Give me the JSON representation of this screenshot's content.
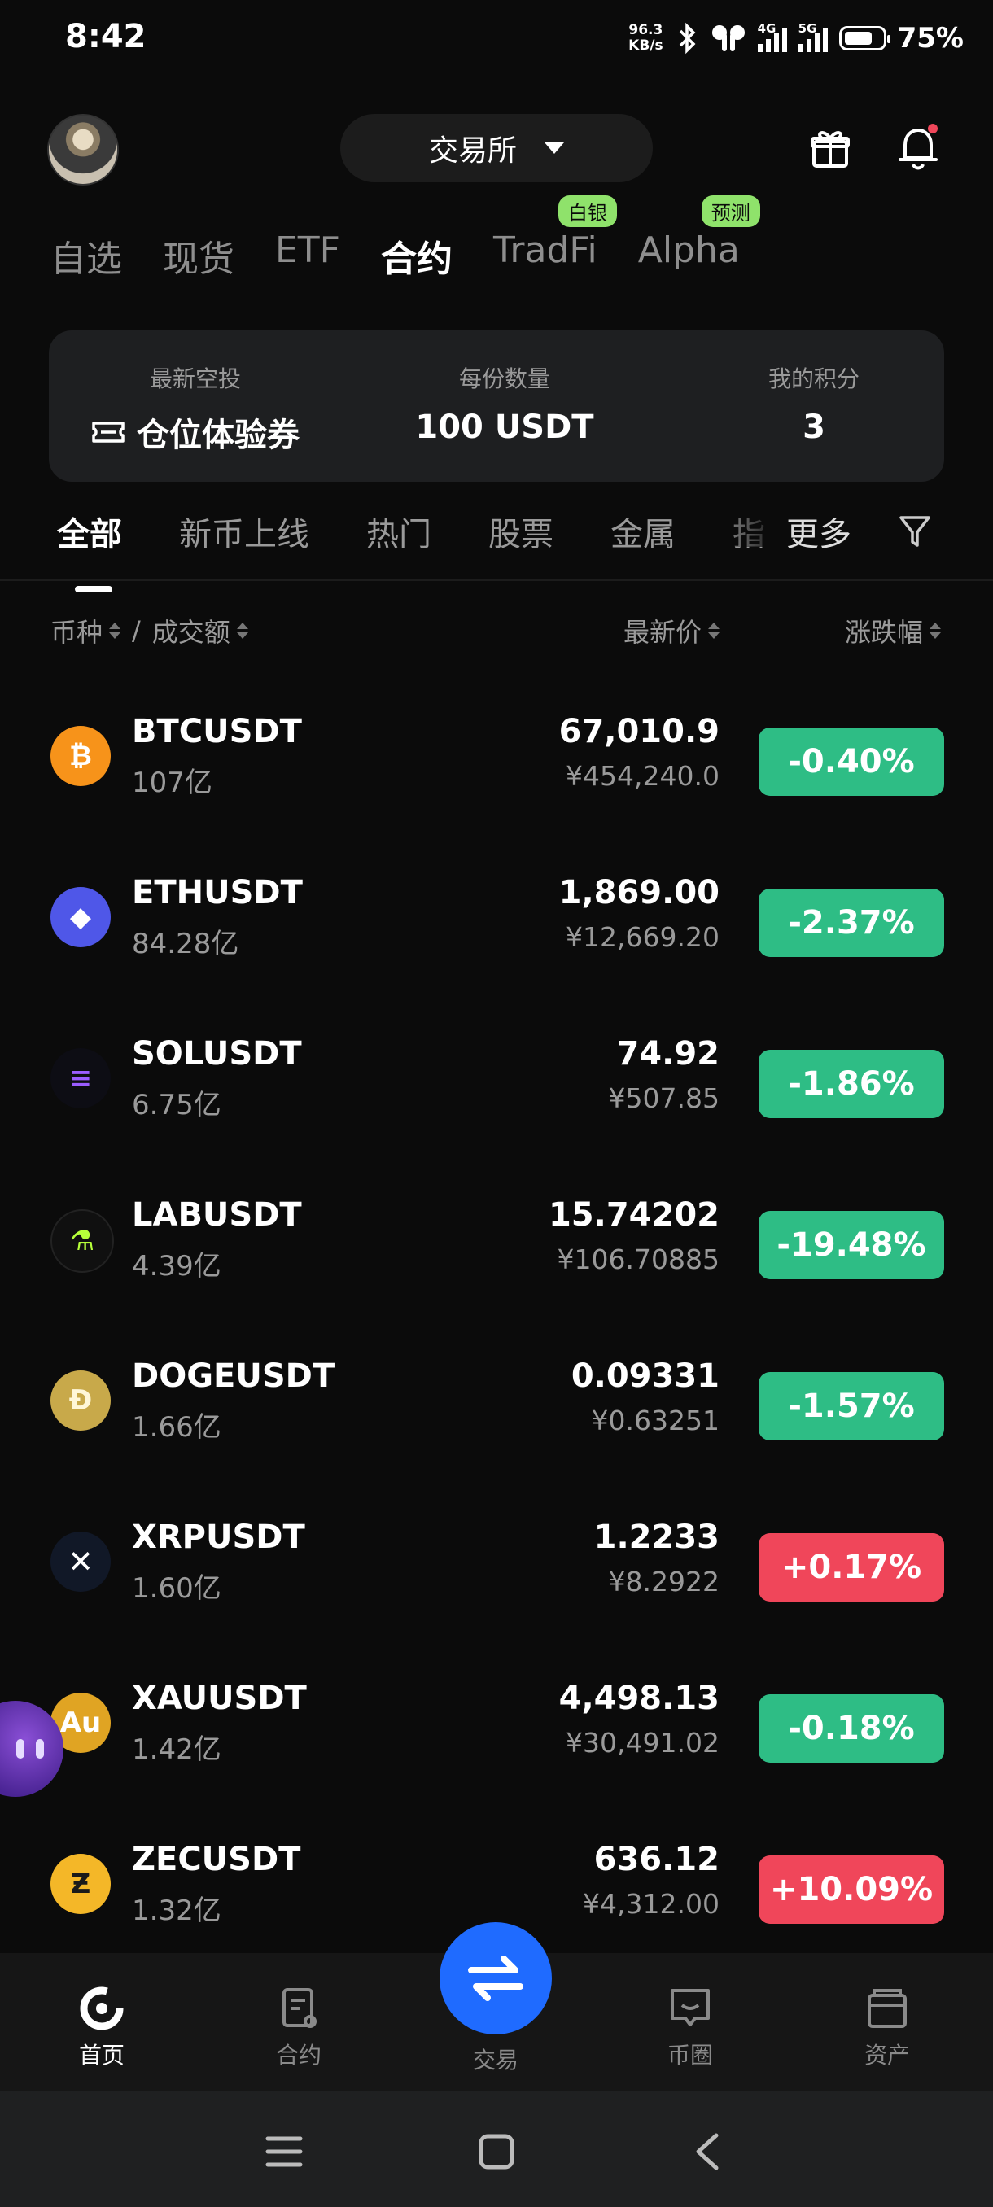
{
  "status_bar": {
    "time": "8:42",
    "net_speed_value": "96.3",
    "net_speed_unit": "KB/s",
    "signal1_label": "4G",
    "signal2_label": "5G",
    "battery_level": 0.75,
    "battery_text": "75%"
  },
  "header": {
    "exchange_label": "交易所"
  },
  "top_tabs": [
    {
      "label": "自选"
    },
    {
      "label": "现货"
    },
    {
      "label": "ETF"
    },
    {
      "label": "合约",
      "active": true
    },
    {
      "label": "TradFi",
      "badge": "白银"
    },
    {
      "label": "Alpha",
      "badge": "预测"
    }
  ],
  "promo": {
    "col1_label": "最新空投",
    "col1_value": "仓位体验券",
    "col2_label": "每份数量",
    "col2_value": "100 USDT",
    "col3_label": "我的积分",
    "col3_value": "3"
  },
  "category_tabs": [
    {
      "label": "全部",
      "active": true
    },
    {
      "label": "新币上线"
    },
    {
      "label": "热门"
    },
    {
      "label": "股票"
    },
    {
      "label": "金属"
    },
    {
      "label": "指"
    }
  ],
  "category_more": "更多",
  "columns": {
    "coin": "币种",
    "separator": "/",
    "volume": "成交额",
    "price": "最新价",
    "change": "涨跌幅"
  },
  "rows": [
    {
      "symbol": "BTCUSDT",
      "volume": "107亿",
      "price": "67,010.9",
      "cny": "¥454,240.0",
      "change": "-0.40%",
      "dir": "down",
      "icon": "bitcoin-icon",
      "icon_color": "#f7931a",
      "glyph": "₿"
    },
    {
      "symbol": "ETHUSDT",
      "volume": "84.28亿",
      "price": "1,869.00",
      "cny": "¥12,669.20",
      "change": "-2.37%",
      "dir": "down",
      "icon": "ethereum-icon",
      "icon_color": "#4f57e8",
      "glyph": "◆"
    },
    {
      "symbol": "SOLUSDT",
      "volume": "6.75亿",
      "price": "74.92",
      "cny": "¥507.85",
      "change": "-1.86%",
      "dir": "down",
      "icon": "solana-icon",
      "icon_color": "#0d0d14",
      "glyph": "≡"
    },
    {
      "symbol": "LABUSDT",
      "volume": "4.39亿",
      "price": "15.74202",
      "cny": "¥106.70885",
      "change": "-19.48%",
      "dir": "down",
      "icon": "lab-flask-icon",
      "icon_color": "#101010",
      "glyph": "⚗"
    },
    {
      "symbol": "DOGEUSDT",
      "volume": "1.66亿",
      "price": "0.09331",
      "cny": "¥0.63251",
      "change": "-1.57%",
      "dir": "down",
      "icon": "dogecoin-icon",
      "icon_color": "#c8a94a",
      "glyph": "Ð"
    },
    {
      "symbol": "XRPUSDT",
      "volume": "1.60亿",
      "price": "1.2233",
      "cny": "¥8.2922",
      "change": "+0.17%",
      "dir": "up",
      "icon": "xrp-icon",
      "icon_color": "#111827",
      "glyph": "✕"
    },
    {
      "symbol": "XAUUSDT",
      "volume": "1.42亿",
      "price": "4,498.13",
      "cny": "¥30,491.02",
      "change": "-0.18%",
      "dir": "down",
      "icon": "gold-au-icon",
      "icon_color": "#e0a423",
      "glyph": "Au"
    },
    {
      "symbol": "ZECUSDT",
      "volume": "1.32亿",
      "price": "636.12",
      "cny": "¥4,312.00",
      "change": "+10.09%",
      "dir": "up",
      "icon": "zcash-icon",
      "icon_color": "#f4b728",
      "glyph": "Ƶ"
    }
  ],
  "bottom_nav": [
    {
      "label": "首页",
      "icon": "home-icon",
      "active": true
    },
    {
      "label": "合约",
      "icon": "contract-icon"
    },
    {
      "label": "交易",
      "icon": "swap-arrows-icon"
    },
    {
      "label": "币圈",
      "icon": "chat-square-icon"
    },
    {
      "label": "资产",
      "icon": "wallet-icon"
    }
  ],
  "colors": {
    "down": "#2ebd85",
    "up": "#f0465a",
    "trade_button": "#1f6bff",
    "badge": "#8fe26b"
  }
}
